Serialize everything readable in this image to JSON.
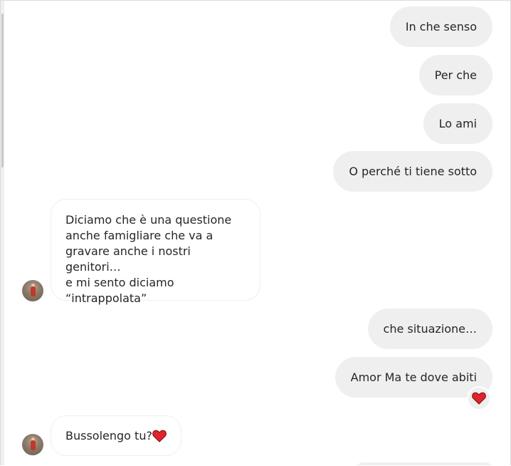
{
  "messages": {
    "m1": "In che senso",
    "m2": "Per che",
    "m3": "Lo ami",
    "m4": "O perché ti tiene sotto",
    "in1": {
      "line1": "Diciamo che è una questione",
      "line2": "anche famigliare che va a",
      "line3": "gravare anche i nostri genitori…",
      "line4": "e mi sento diciamo",
      "line5": "“intrappolata”"
    },
    "m5": "che situazione…",
    "m6": "Amor Ma te dove abiti",
    "in2": "Bussolengo tu?"
  },
  "icons": {
    "reaction": "red-heart-icon",
    "inline_emoji": "red-heart-icon",
    "avatar": "user-avatar"
  },
  "colors": {
    "outgoing_bubble": "#efefef",
    "incoming_border": "#efefef",
    "heart": "#e0242d"
  }
}
